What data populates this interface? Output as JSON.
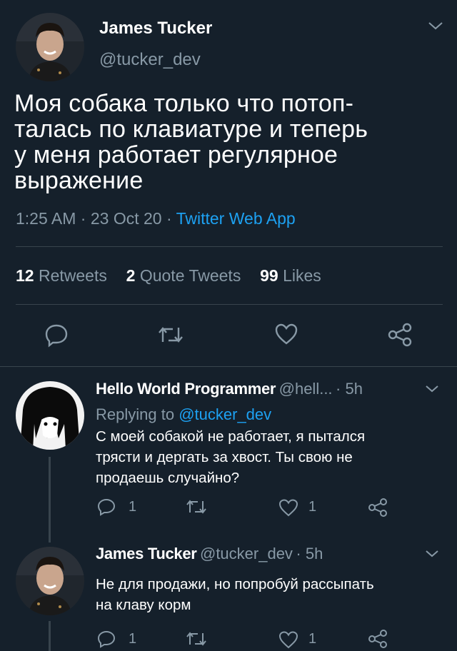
{
  "main_tweet": {
    "author_name": "James Tucker",
    "author_handle": "@tucker_dev",
    "text": "Моя собака только что потоп-\nталась по клавиатуре и теперь\nу меня работает регулярное\nвыражение",
    "time": "1:25 AM",
    "date": "23 Oct 20",
    "source": "Twitter Web App",
    "stats": {
      "retweets_count": "12",
      "retweets_label": "Retweets",
      "quotes_count": "2",
      "quotes_label": "Quote Tweets",
      "likes_count": "99",
      "likes_label": "Likes"
    }
  },
  "replies": [
    {
      "author_name": "Hello World Programmer",
      "author_handle": "@hell...",
      "age": "5h",
      "replying_prefix": "Replying to",
      "replying_to": "@tucker_dev",
      "text": "С моей собакой не работает, я пытался\nтрясти и дергать за хвост. Ты свою не\nпродаешь случайно?",
      "reply_count": "1",
      "like_count": "1"
    },
    {
      "author_name": "James Tucker",
      "author_handle": "@tucker_dev",
      "age": "5h",
      "text": "Не для продажи, но попробуй рассыпать\nна клаву корм",
      "reply_count": "1",
      "like_count": "1"
    }
  ],
  "colors": {
    "background": "#15202b",
    "accent": "#1da1f2",
    "muted": "#8899a6",
    "divider": "#38444d"
  },
  "icons": [
    "chevron-down-icon",
    "reply-icon",
    "retweet-icon",
    "like-icon",
    "share-icon"
  ]
}
